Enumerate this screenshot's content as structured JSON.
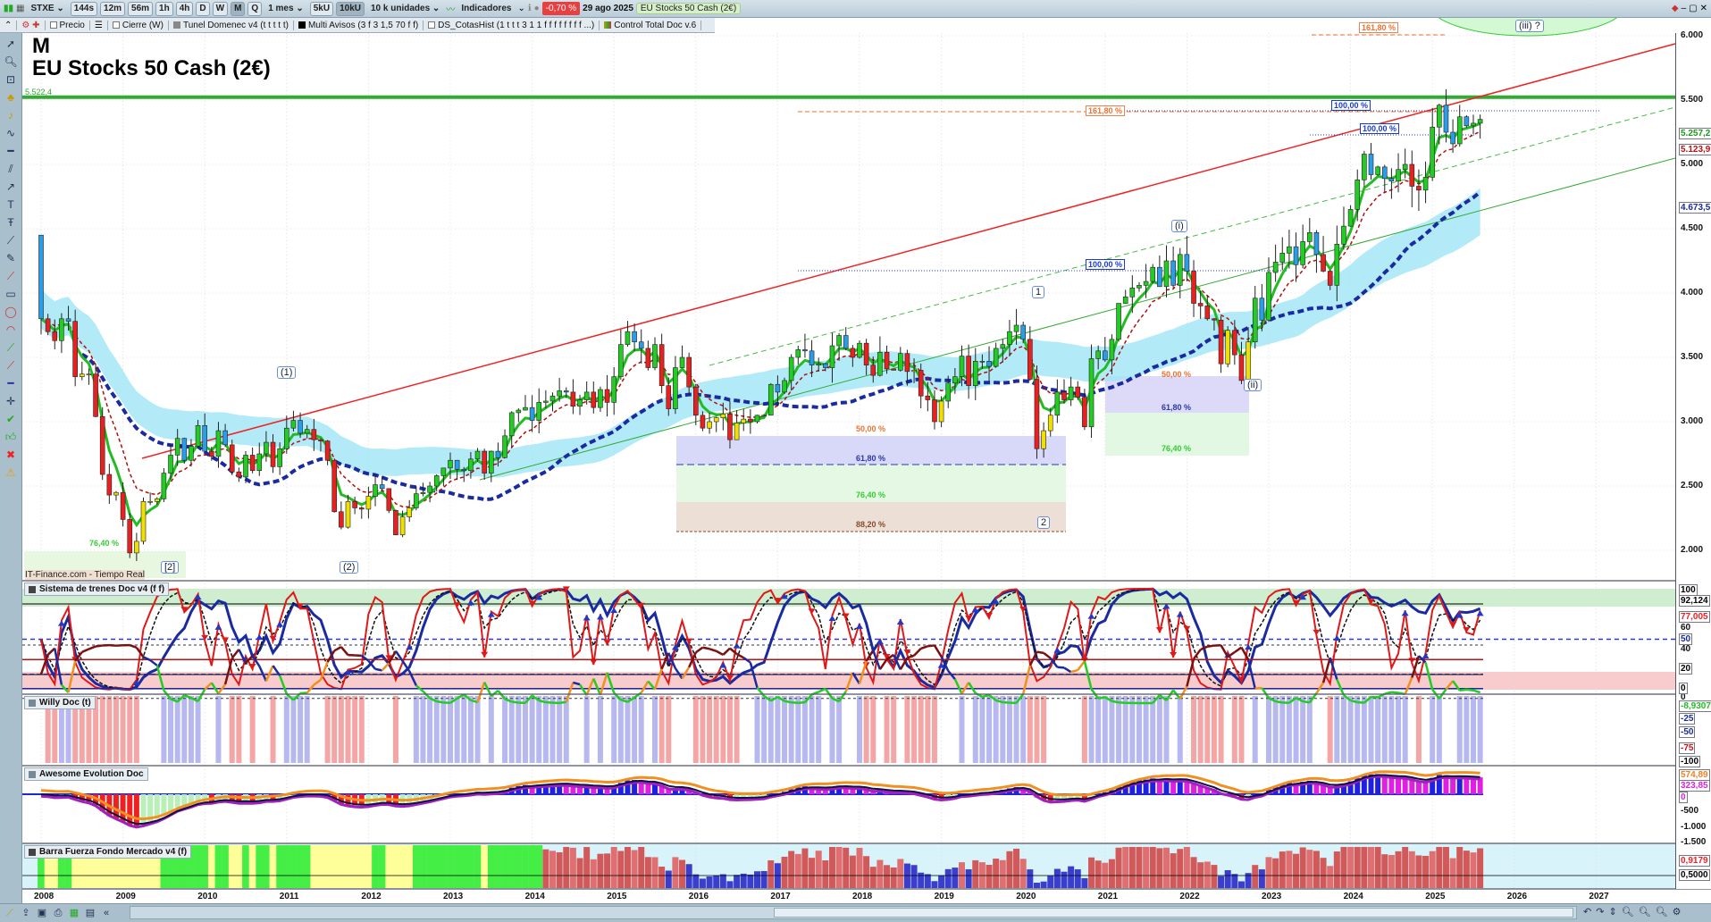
{
  "toolbar": {
    "symbol": "STXE",
    "intervals": [
      "144s",
      "12m",
      "56m",
      "1h",
      "4h",
      "D",
      "W",
      "M",
      "Q"
    ],
    "active_interval": "M",
    "period": "1 mes",
    "units_buttons": [
      "5kU",
      "10kU"
    ],
    "units": "10 k unidades",
    "indicators": "Indicadores",
    "change": "-0,70 %",
    "date": "29 ago 2025",
    "instrument": "EU Stocks 50 Cash (2€)"
  },
  "subbar": {
    "items": [
      "Precio",
      "Cierre (W)",
      "Tunel Domenec v4 (t t t t t)",
      "Multi Avisos (3 f 3 1,5 70 f f)",
      "DS_CotasHist (1 t t t 3 1 1 f f f f f f f f ...)",
      "Control Total Doc v.6"
    ]
  },
  "chart_title": {
    "period": "M",
    "name": "EU Stocks 50 Cash (2€)",
    "level_label": "5.522,4",
    "watermark": "IT-Finance.com - Tiempo Real"
  },
  "annotations": {
    "w1": "(1)",
    "w2": "(2)",
    "w2b": "[2]",
    "a1": "1",
    "a2": "2",
    "i": "(i)",
    "ii": "(ii)",
    "iii": "(iii) ?"
  },
  "fib": {
    "f161a": "161,80 %",
    "f161b": "161,80 %",
    "f100a": "100,00 %",
    "f100b": "100,00 %",
    "f100c": "100,00 %",
    "f50a": "50,00 %",
    "f618a": "61,80 %",
    "f764a": "76,40 %",
    "f882a": "88,20 %",
    "f50b": "50,00 %",
    "f618b": "61,80 %",
    "f764b": "76,40 %",
    "f764c": "76,40 %"
  },
  "price_axis": {
    "ticks": [
      {
        "v": 6000,
        "l": "6.000"
      },
      {
        "v": 5500,
        "l": "5.500"
      },
      {
        "v": 5000,
        "l": "5.000"
      },
      {
        "v": 4500,
        "l": "4.500"
      },
      {
        "v": 4000,
        "l": "4.000"
      },
      {
        "v": 3500,
        "l": "3.500"
      },
      {
        "v": 3000,
        "l": "3.000"
      },
      {
        "v": 2500,
        "l": "2.500"
      },
      {
        "v": 2000,
        "l": "2.000"
      }
    ],
    "tag_green": "5.257,2",
    "tag_red": "5.123,9",
    "tag_blue": "4.673,5"
  },
  "panels": {
    "trenes": {
      "label": "Sistema de trenes Doc v4 (f f)",
      "ticks": [
        "100",
        "92,124",
        "77,005",
        "60",
        "50",
        "40",
        "20",
        "0"
      ]
    },
    "willy": {
      "label": "Willy Doc (t)",
      "ticks": [
        "0",
        "-8,9307",
        "-25",
        "-50",
        "-75",
        "-100"
      ]
    },
    "awesome": {
      "label": "Awesome Evolution Doc",
      "ticks": [
        "574,89",
        "323,85",
        "0",
        "-500",
        "-1.000",
        "-1.500"
      ]
    },
    "barra": {
      "label": "Barra Fuerza Fondo Mercado v4 (f)",
      "ticks": [
        "0,9179",
        "0,5000"
      ]
    }
  },
  "colors": {
    "up_above": "#22cc22",
    "up_below": "#f0e000",
    "down_above": "#2a9de8",
    "down_below": "#e82020",
    "trend_red": "#ee2222",
    "level_green": "#33aa33",
    "ma_blue": "#1a2aa0",
    "tunnel": "#9fe6f5"
  },
  "chart_data": {
    "type": "candlestick",
    "title": "EU Stocks 50 Cash (2€)",
    "interval": "1 mes",
    "start": "2008-01",
    "first_open": 4450,
    "x_labels": [
      "2008",
      "2009",
      "2010",
      "2011",
      "2012",
      "2013",
      "2014",
      "2015",
      "2016",
      "2017",
      "2018",
      "2019",
      "2020",
      "2021",
      "2022",
      "2023",
      "2024",
      "2025",
      "2026",
      "2027"
    ],
    "ylim": [
      1950,
      6050
    ],
    "resistance": 5522.4,
    "monthly_close": [
      3800,
      3700,
      3630,
      3800,
      3780,
      3350,
      3370,
      3370,
      3040,
      2590,
      2430,
      2450,
      2240,
      1980,
      2070,
      2380,
      2380,
      2400,
      2600,
      2740,
      2870,
      2700,
      2810,
      2970,
      2770,
      2730,
      2930,
      2820,
      2610,
      2570,
      2740,
      2620,
      2750,
      2840,
      2650,
      2790,
      2950,
      3010,
      2910,
      2940,
      2860,
      2850,
      2700,
      2300,
      2180,
      2380,
      2330,
      2320,
      2420,
      2510,
      2480,
      2310,
      2120,
      2260,
      2330,
      2440,
      2450,
      2500,
      2580,
      2640,
      2700,
      2630,
      2620,
      2710,
      2770,
      2600,
      2770,
      2720,
      2890,
      3070,
      3090,
      3110,
      3010,
      3150,
      3160,
      3200,
      3240,
      3230,
      3120,
      3170,
      3230,
      3110,
      3250,
      3150,
      3350,
      3600,
      3700,
      3620,
      3570,
      3420,
      3600,
      3280,
      3100,
      3420,
      3500,
      3270,
      3050,
      2950,
      3000,
      3030,
      3060,
      2860,
      2990,
      3020,
      3000,
      3050,
      3050,
      3290,
      3230,
      3320,
      3500,
      3560,
      3550,
      3440,
      3450,
      3420,
      3590,
      3670,
      3570,
      3500,
      3610,
      3440,
      3360,
      3540,
      3410,
      3400,
      3530,
      3390,
      3400,
      3200,
      3170,
      3000,
      3160,
      3300,
      3350,
      3510,
      3280,
      3470,
      3470,
      3430,
      3570,
      3600,
      3700,
      3750,
      3640,
      3330,
      2790,
      2930,
      3050,
      3230,
      3170,
      3270,
      3190,
      2960,
      3490,
      3550,
      3480,
      3640,
      3920,
      3970,
      4040,
      4060,
      4090,
      4200,
      4050,
      4250,
      4060,
      4300,
      4170,
      3920,
      3900,
      3800,
      3790,
      3450,
      3710,
      3520,
      3320,
      3620,
      3960,
      3790,
      4160,
      4240,
      4310,
      4360,
      4220,
      4400,
      4470,
      4300,
      4170,
      4060,
      4380,
      4520,
      4650,
      4880,
      5080,
      4920,
      4980,
      4890,
      4870,
      4960,
      5000,
      4830,
      4800,
      4900,
      5290,
      5460,
      5250,
      5160,
      5370,
      5300,
      5320,
      5350
    ]
  }
}
